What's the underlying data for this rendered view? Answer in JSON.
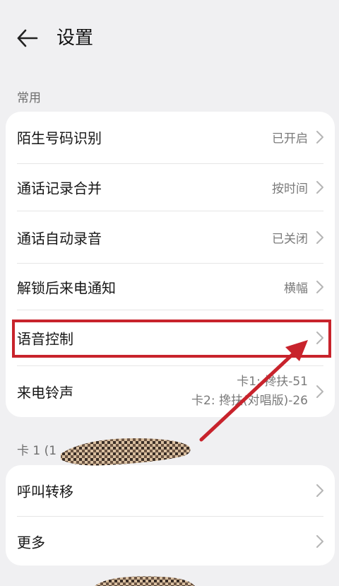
{
  "header": {
    "title": "设置"
  },
  "section_common": {
    "label": "常用"
  },
  "common_items": [
    {
      "label": "陌生号码识别",
      "value": "已开启"
    },
    {
      "label": "通话记录合并",
      "value": "按时间"
    },
    {
      "label": "通话自动录音",
      "value": "已关闭"
    },
    {
      "label": "解锁后来电通知",
      "value": "横幅"
    },
    {
      "label": "语音控制",
      "value": ""
    },
    {
      "label": "来电铃声",
      "value_line1": "卡1: 搀扶-51",
      "value_line2": "卡2: 搀扶(对唱版)-26"
    }
  ],
  "section_card1": {
    "label": "卡 1 (1"
  },
  "card1_items": [
    {
      "label": "呼叫转移"
    },
    {
      "label": "更多"
    }
  ],
  "colors": {
    "background": "#f0f0f2",
    "card": "#ffffff",
    "annotation_red": "#c8232c",
    "secondary_text": "#7a7a7a"
  },
  "icons": {
    "back": "arrow-left-icon",
    "chevron": "chevron-right-icon"
  }
}
